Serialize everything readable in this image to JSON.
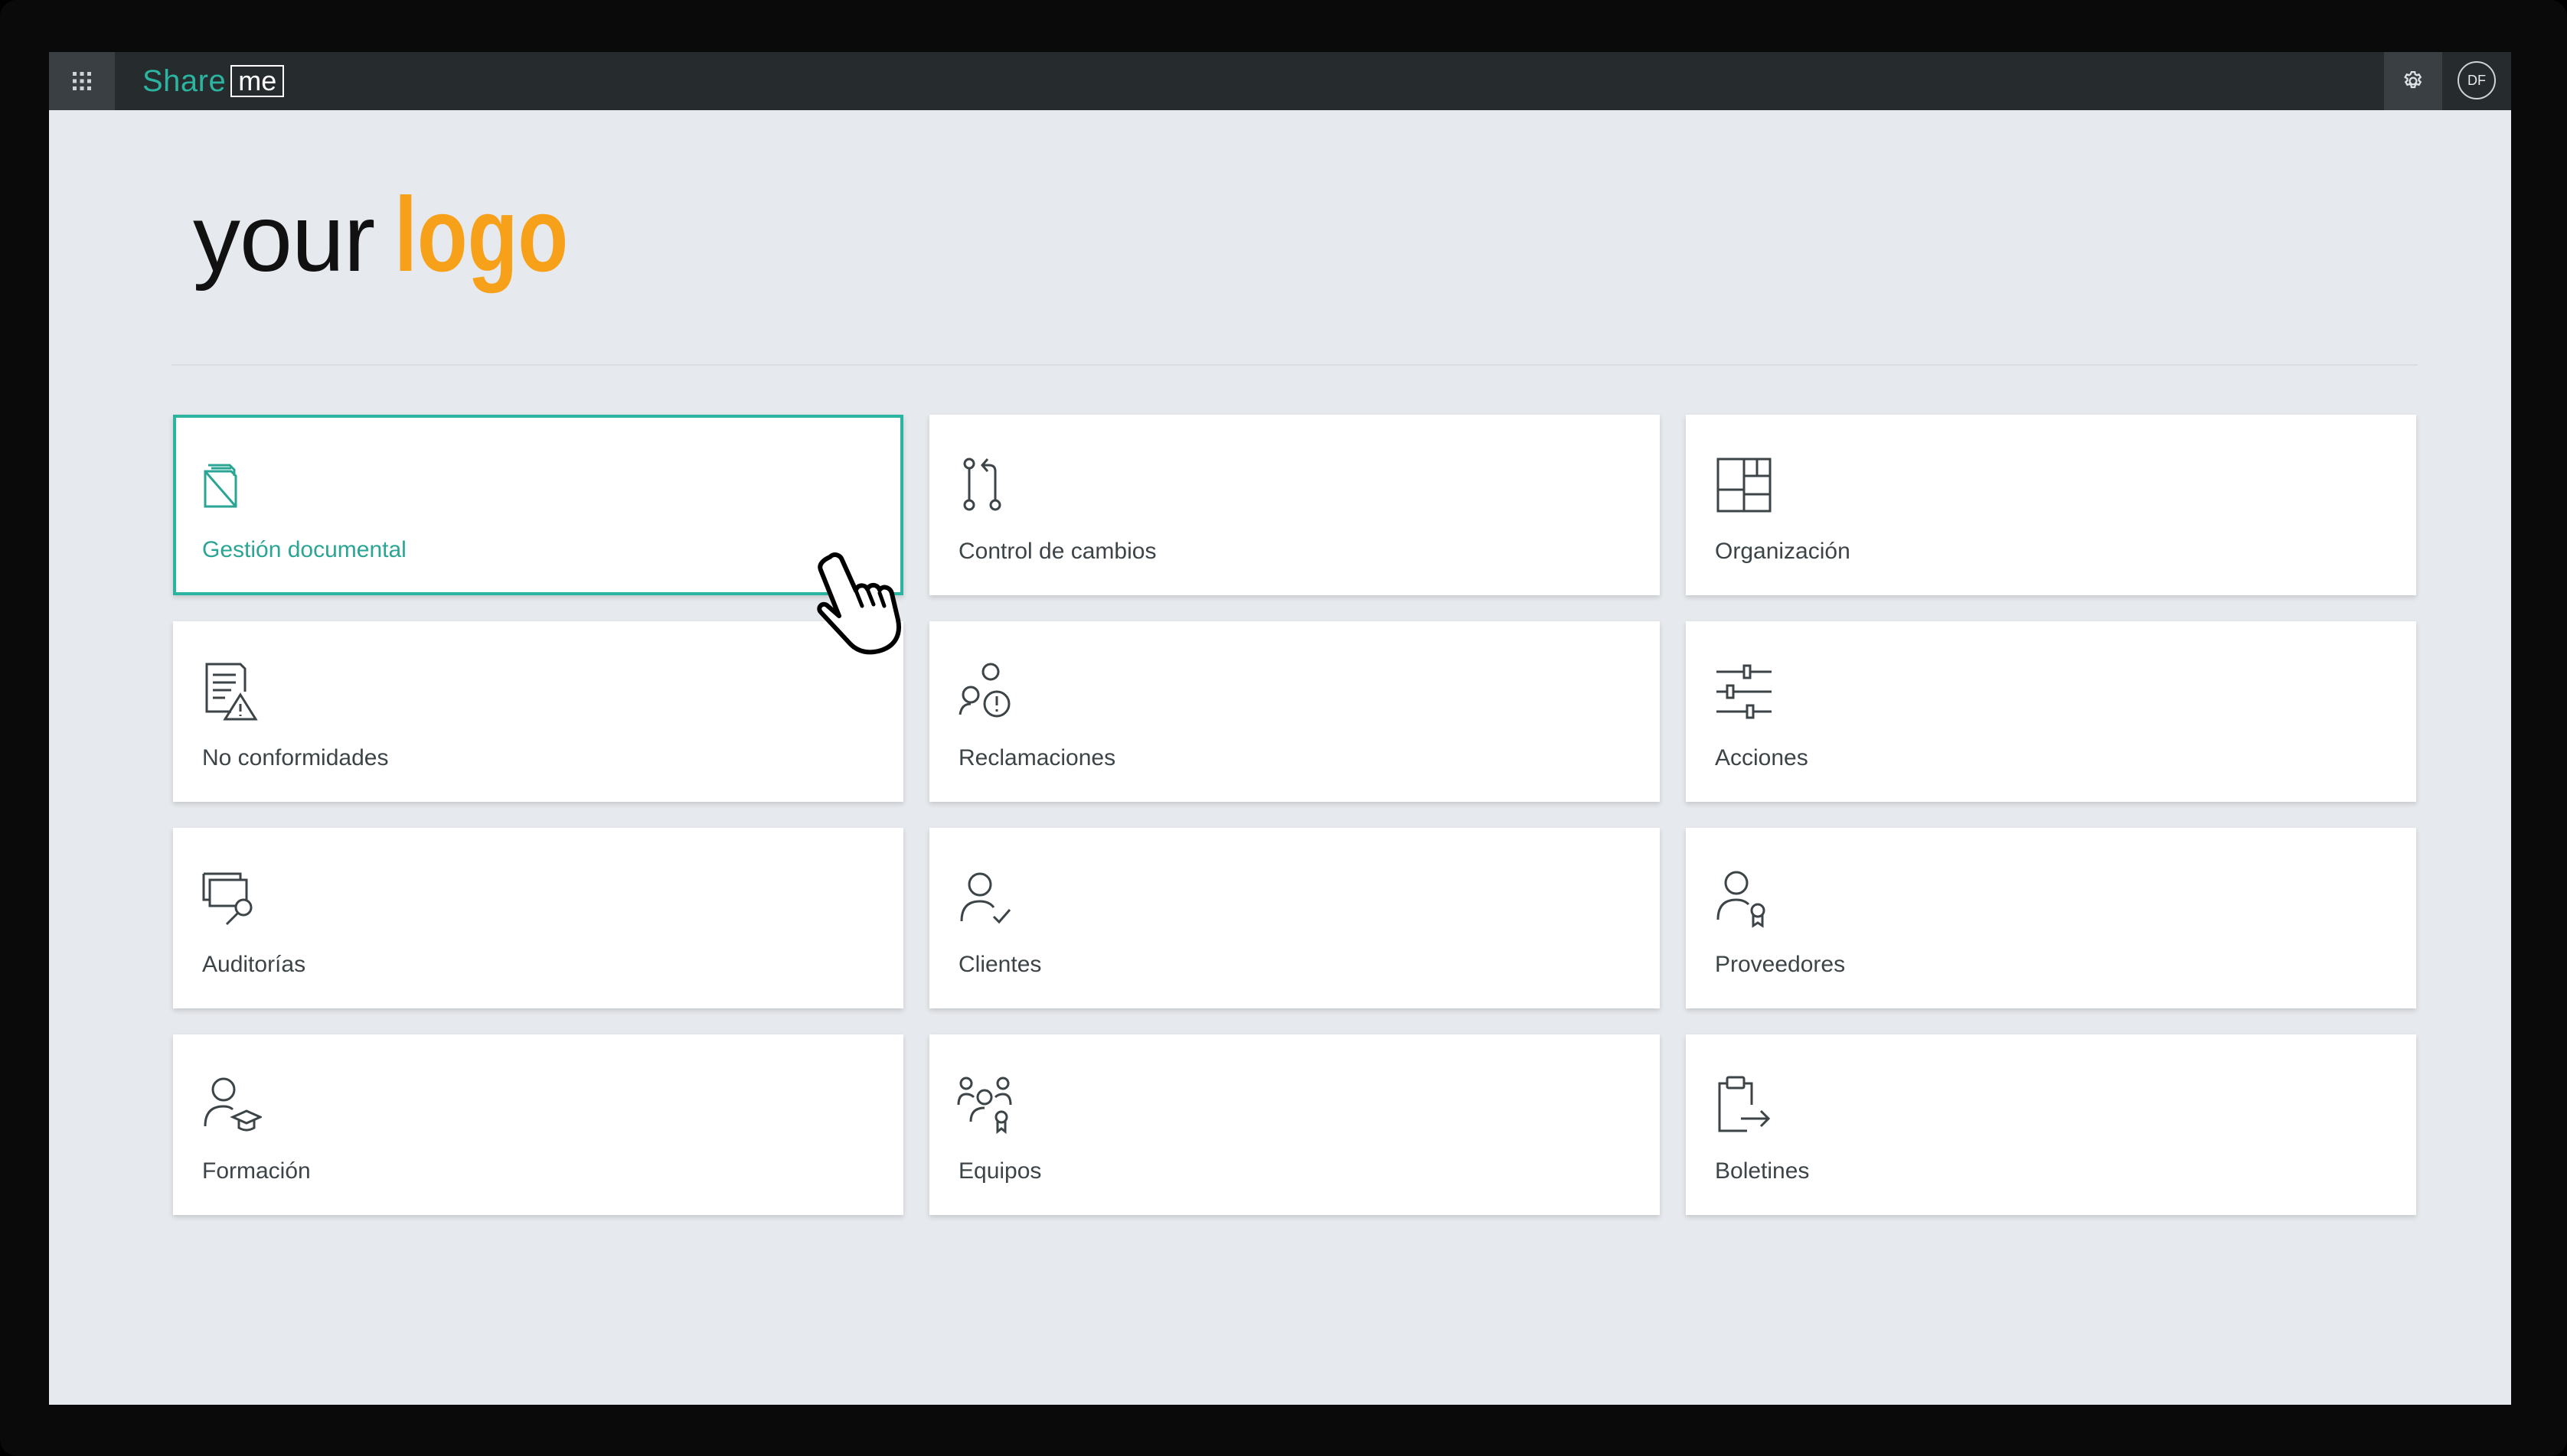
{
  "topbar": {
    "app_launcher_icon": "waffle-grid-icon",
    "brand_part1": "Share",
    "brand_part2": "me",
    "settings_icon": "gear-icon",
    "avatar_initials": "DF"
  },
  "logo": {
    "part1": "your",
    "part2": "logo",
    "accent_color": "#f7a11a"
  },
  "accent_color": "#2bb5a0",
  "tiles": [
    {
      "label": "Gestión documental",
      "icon": "documents-stack-icon",
      "active": true
    },
    {
      "label": "Control de cambios",
      "icon": "git-compare-icon"
    },
    {
      "label": "Organización",
      "icon": "layout-blocks-icon"
    },
    {
      "label": "No conformidades",
      "icon": "document-warning-icon"
    },
    {
      "label": "Reclamaciones",
      "icon": "people-alert-icon"
    },
    {
      "label": "Acciones",
      "icon": "sliders-icon"
    },
    {
      "label": "Auditorías",
      "icon": "screens-search-icon"
    },
    {
      "label": "Clientes",
      "icon": "person-check-icon"
    },
    {
      "label": "Proveedores",
      "icon": "person-badge-icon"
    },
    {
      "label": "Formación",
      "icon": "person-graduation-icon"
    },
    {
      "label": "Equipos",
      "icon": "team-icon"
    },
    {
      "label": "Boletines",
      "icon": "clipboard-export-icon"
    }
  ]
}
